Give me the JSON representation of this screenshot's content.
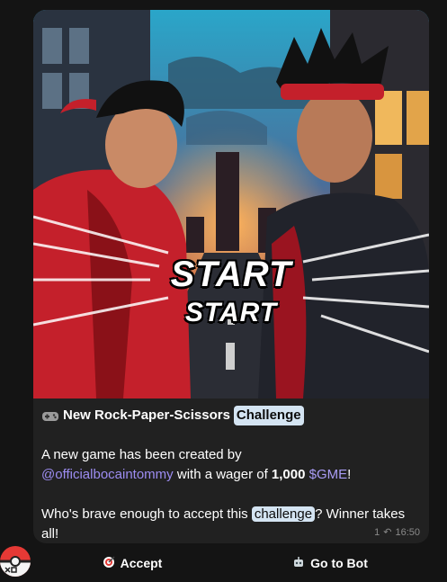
{
  "message": {
    "title_prefix": "New Rock-Paper-Scissors",
    "title_highlight": "Challenge",
    "intro_line": "A new game has been created by",
    "creator": "@officialbocaintommy",
    "wager_text": " with a wager of ",
    "wager_amount": "1,000",
    "token": "$GME",
    "exclamation": "!",
    "question_prefix": "Who's brave enough to accept this ",
    "question_highlight": "challenge",
    "question_suffix": "? Winner takes all!",
    "reply_count": "1",
    "time": "16:50",
    "image_text_1": "START",
    "image_text_2": "START"
  },
  "buttons": {
    "accept_label": "Accept",
    "go_to_bot_label": "Go to Bot"
  },
  "icons": {
    "title_icon": "gamepad-icon",
    "accept_icon": "target-icon",
    "bot_icon": "robot-icon",
    "reply_icon": "reply-arrow-icon",
    "avatar": "rock-paper-scissors-bot-avatar"
  },
  "colors": {
    "bubble": "#212121",
    "highlight": "#d4e4f2",
    "mention": "#9d8df2",
    "background": "#121212"
  }
}
